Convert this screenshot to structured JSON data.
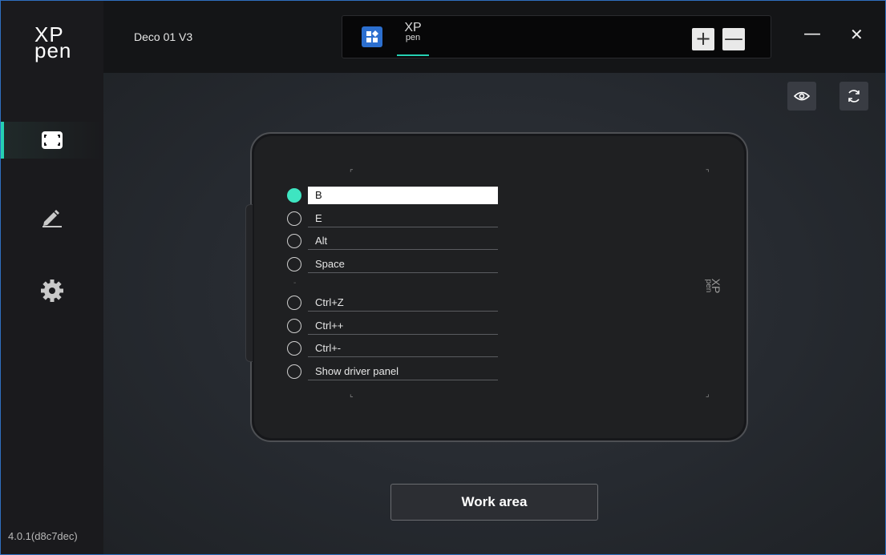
{
  "app": {
    "logo_line1": "XP",
    "logo_line2": "pen",
    "version": "4.0.1(d8c7dec)"
  },
  "titlebar": {
    "device_name": "Deco 01 V3",
    "apps": [
      {
        "name": "all-apps"
      },
      {
        "name": "xppen",
        "label_top": "XP",
        "label_bottom": "pen"
      }
    ],
    "add_label": "+",
    "remove_label": "—",
    "minimize_label": "—",
    "close_label": "✕"
  },
  "sidebar": {
    "items": [
      {
        "icon": "tablet-area-icon",
        "active": true
      },
      {
        "icon": "pen-icon",
        "active": false
      },
      {
        "icon": "gear-icon",
        "active": false
      }
    ]
  },
  "tablet": {
    "logo_top": "XP",
    "logo_bottom": "pen",
    "keys": [
      {
        "label": "B",
        "selected": true
      },
      {
        "label": "E",
        "selected": false
      },
      {
        "label": "Alt",
        "selected": false
      },
      {
        "label": "Space",
        "selected": false
      },
      {
        "label": "Ctrl+Z",
        "selected": false
      },
      {
        "label": "Ctrl++",
        "selected": false
      },
      {
        "label": "Ctrl+-",
        "selected": false
      },
      {
        "label": "Show driver panel",
        "selected": false
      }
    ]
  },
  "main": {
    "work_area_label": "Work area"
  },
  "colors": {
    "accent": "#25d0b3",
    "selected_radio": "#3ee5c1",
    "app_icon_blue": "#2c6fcf"
  }
}
